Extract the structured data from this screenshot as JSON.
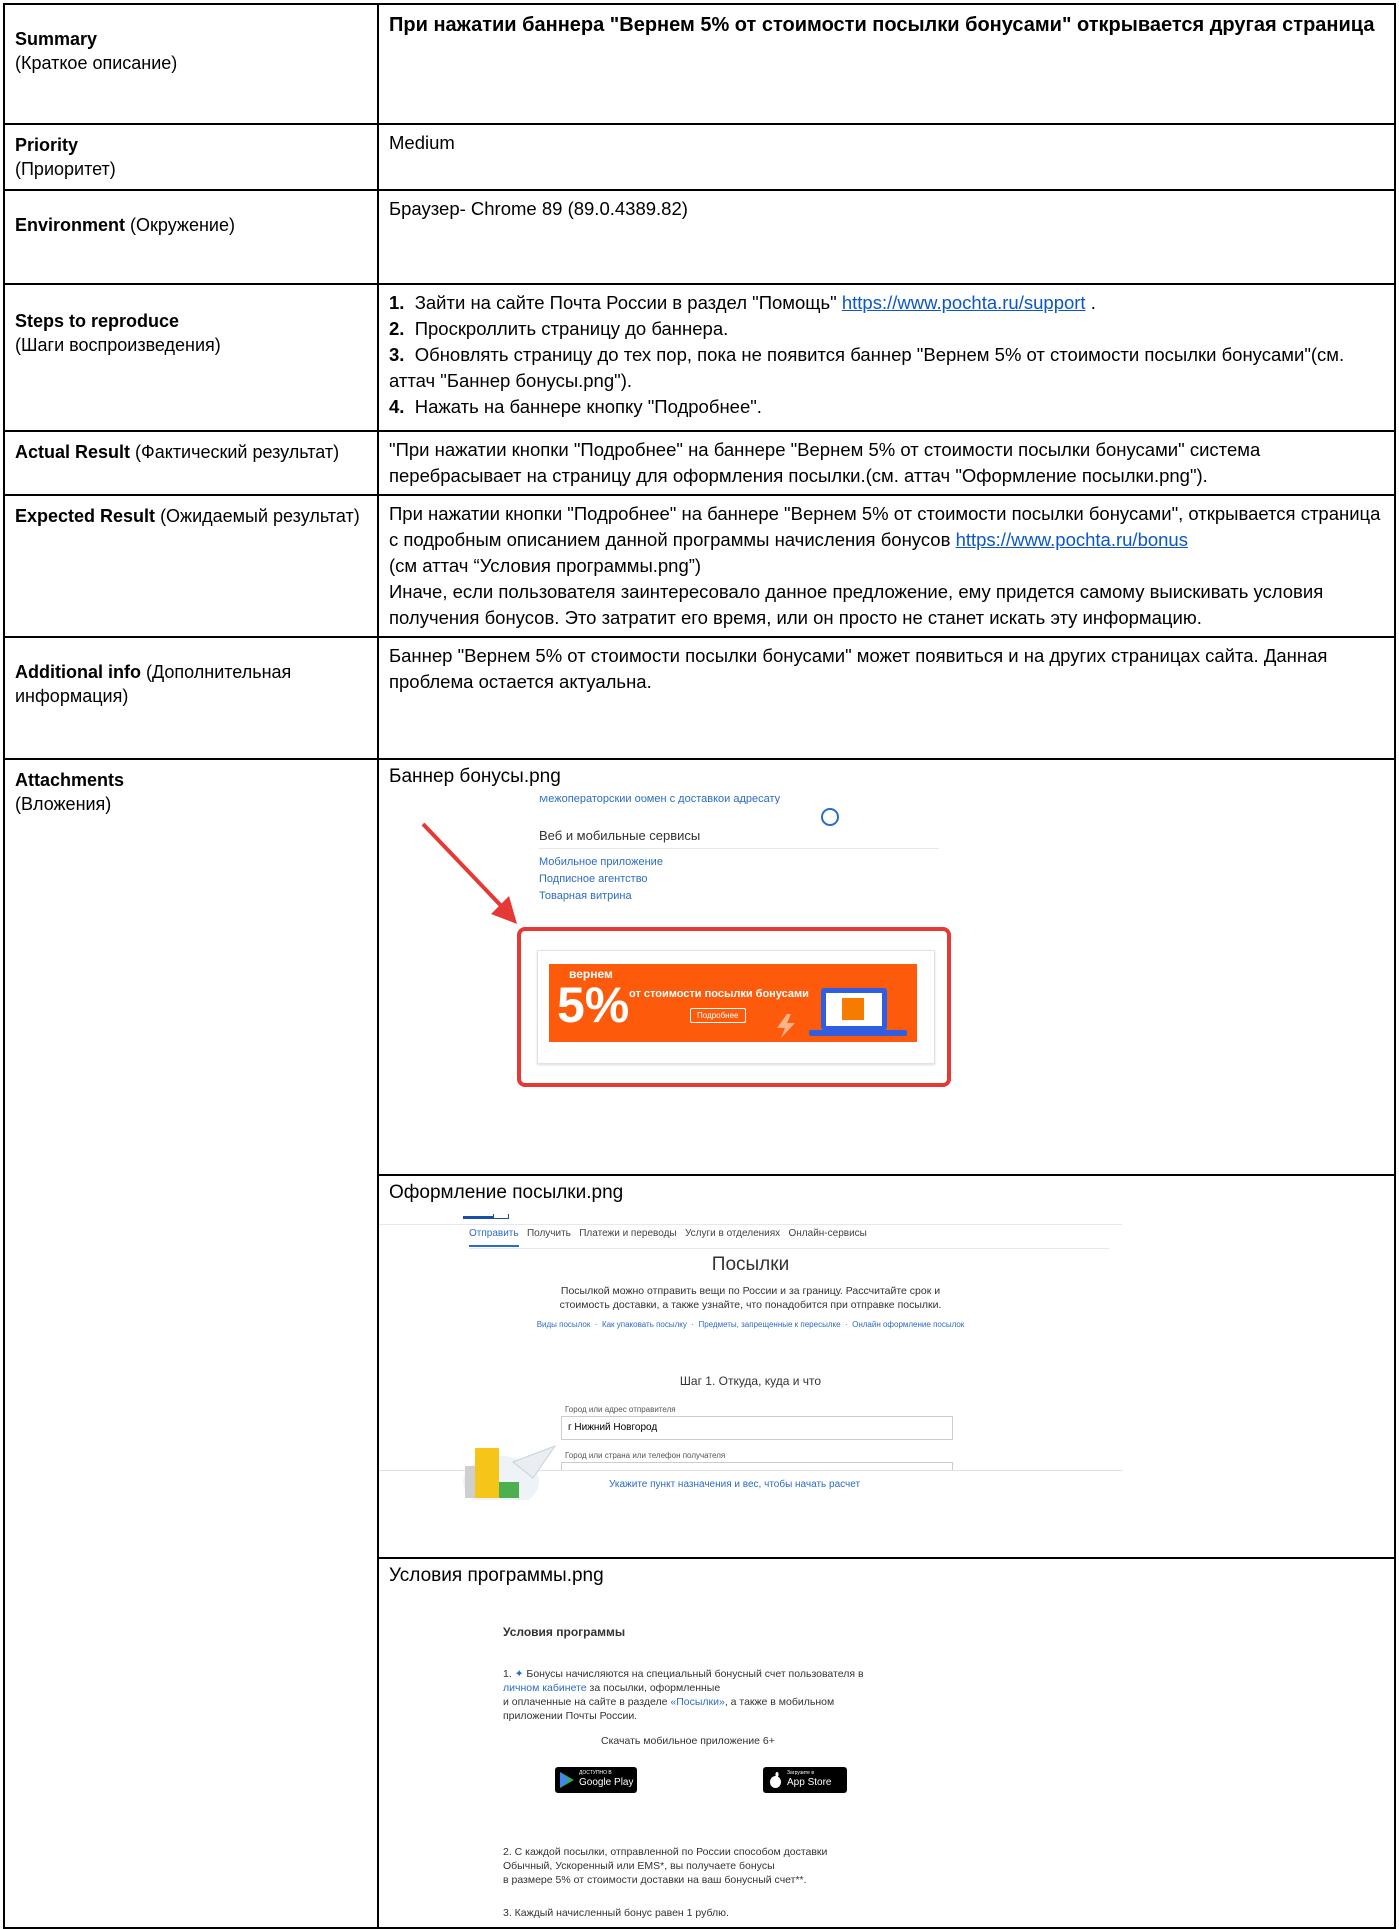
{
  "rows": {
    "summary": {
      "label": "Summary",
      "label_ru": "(Краткое описание)",
      "value": "При нажатии баннера \"Вернем 5% от стоимости посылки бонусами\" открывается другая страница"
    },
    "priority": {
      "label": "Priority",
      "label_ru": "(Приоритет)",
      "value": "Medium"
    },
    "environment": {
      "label": "Environment",
      "label_ru": "(Окружение)",
      "value": "Браузер- Chrome 89 (89.0.4389.82)"
    },
    "steps": {
      "label": "Steps to reproduce",
      "label_ru": "(Шаги воспроизведения)",
      "items": [
        {
          "num": "1.",
          "text": "Зайти на сайте Почта России в раздел \"Помощь\"",
          "link": "https://www.pochta.ru/support",
          "after": "."
        },
        {
          "num": "2.",
          "text": "Проскроллить страницу до баннера."
        },
        {
          "num": "3.",
          "text": "Обновлять страницу до тех пор, пока не появится баннер \"Вернем 5% от стоимости посылки бонусами\"(см. аттач \"Баннер бонусы.png\")."
        },
        {
          "num": "4.",
          "text": "Нажать на баннере кнопку \"Подробнее\"."
        }
      ]
    },
    "actual": {
      "label": "Actual Result",
      "label_ru": "(Фактический результат)",
      "value": "\"При нажатии кнопки \"Подробнее\" на баннере \"Вернем 5% от стоимости посылки бонусами\" система перебрасывает на страницу для оформления посылки.(см. аттач \"Оформление посылки.png\")."
    },
    "expected": {
      "label": "Expected Result",
      "label_ru": "(Ожидаемый результат)",
      "part1": "При нажатии кнопки \"Подробнее\" на баннере \"Вернем 5% от стоимости посылки бонусами\", открывается страница с подробным описанием данной программы начисления бонусов",
      "link": "https://www.pochta.ru/bonus",
      "part2": "(см аттач “Условия программы.png”)",
      "part3": "Иначе, если пользователя заинтересовало данное предложение, ему придется самому выискивать условия получения бонусов. Это затратит его время, или он просто не станет искать эту информацию."
    },
    "additional": {
      "label": "Additional info",
      "label_ru": "(Дополнительная информация)",
      "value": "Баннер \"Вернем 5% от стоимости посылки бонусами\" может появиться и на других страницах сайта. Данная проблема остается актуальна."
    },
    "attachments": {
      "label": "Attachments",
      "label_ru": "(Вложения)"
    }
  },
  "att1": {
    "title": "Баннер бонусы.png",
    "top_clip": "Межоператорский обмен с доставкой адресату",
    "section": "Веб и мобильные сервисы",
    "links": [
      "Мобильное приложение",
      "Подписное агентство",
      "Товарная витрина"
    ],
    "banner_top": "вернем",
    "banner_big": "5%",
    "banner_sub": "от стоимости посылки бонусами",
    "banner_button": "Подробнее",
    "colors": {
      "banner": "#fd5a0b",
      "frame": "#e53935",
      "arrow": "#e53935"
    }
  },
  "att2": {
    "title": "Оформление посылки.png",
    "tabs": [
      "Отправить",
      "Получить",
      "Платежи и переводы",
      "Услуги в отделениях",
      "Онлайн-сервисы"
    ],
    "heading": "Посылки",
    "desc1": "Посылкой можно отправить вещи по России и за границу. Рассчитайте срок и",
    "desc2": "стоимость доставки, а также узнайте, что понадобится при отправке посылки.",
    "links": [
      "Виды посылок",
      "Как упаковать посылку",
      "Предметы, запрещенные к пересылке",
      "Онлайн оформление посылок"
    ],
    "step": "Шаг 1. Откуда, куда и что",
    "from_label": "Город или адрес отправителя",
    "from_value": "г Нижний Новгород",
    "to_label": "Город или страна или телефон получателя",
    "bottom_bar": "Укажите пункт назначения и вес, чтобы начать расчет"
  },
  "att3": {
    "title": "Условия программы.png",
    "heading": "Условия программы",
    "p1_a": "1.",
    "p1_b": "Бонусы начисляются на специальный бонусный счет пользователя в",
    "p1_link1": "личном кабинете",
    "p1_c": "за посылки, оформленные",
    "p1_d": "и оплаченные на сайте в разделе",
    "p1_link2": "«Посылки»",
    "p1_e": ", а также в мобильном",
    "p1_f": "приложении Почты России.",
    "download": "Скачать мобильное приложение 6+",
    "gp_small": "ДОСТУПНО В",
    "gp_big": "Google Play",
    "as_small": "Загрузите в",
    "as_big": "App Store",
    "p2_1": "2. С каждой посылки, отправленной по России способом доставки",
    "p2_2": "Обычный, Ускоренный или EMS*, вы получаете бонусы",
    "p2_3": "в размере 5% от стоимости доставки на ваш бонусный счет**.",
    "p3": "3. Каждый начисленный бонус равен 1 рублю."
  }
}
